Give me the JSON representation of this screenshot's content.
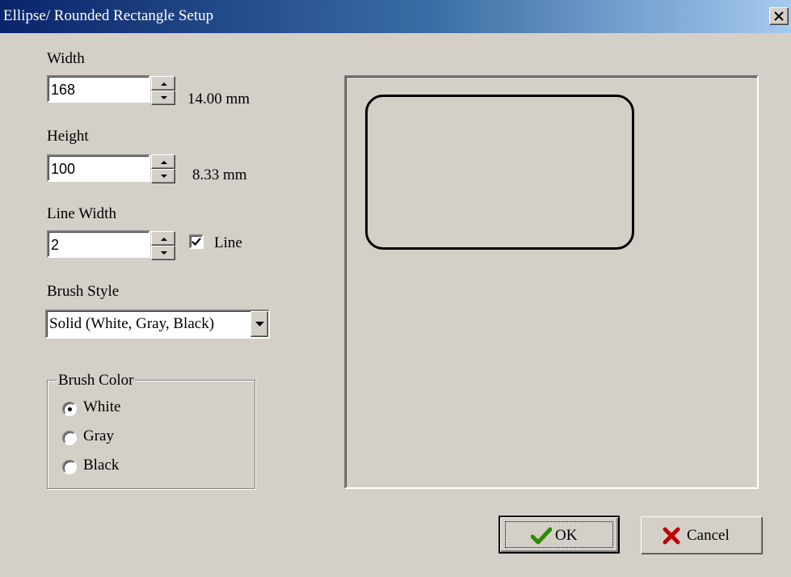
{
  "window": {
    "title": "Ellipse/ Rounded Rectangle Setup"
  },
  "width": {
    "label": "Width",
    "value": "168",
    "unit_text": "14.00 mm"
  },
  "height": {
    "label": "Height",
    "value": "100",
    "unit_text": "8.33 mm"
  },
  "line_width": {
    "label": "Line Width",
    "value": "2",
    "line_checkbox_label": "Line",
    "line_checked": true
  },
  "brush_style": {
    "label": "Brush Style",
    "selected": "Solid (White, Gray, Black)"
  },
  "brush_color": {
    "group_label": "Brush Color",
    "options": [
      "White",
      "Gray",
      "Black"
    ],
    "selected": "White"
  },
  "buttons": {
    "ok": "OK",
    "cancel": "Cancel"
  },
  "icons": {
    "close": "close-icon",
    "ok": "checkmark-icon",
    "cancel": "x-icon"
  },
  "colors": {
    "ok_icon": "#2e8b00",
    "cancel_icon": "#c00000",
    "titlebar_start": "#0a246a",
    "titlebar_end": "#a6caf0"
  }
}
